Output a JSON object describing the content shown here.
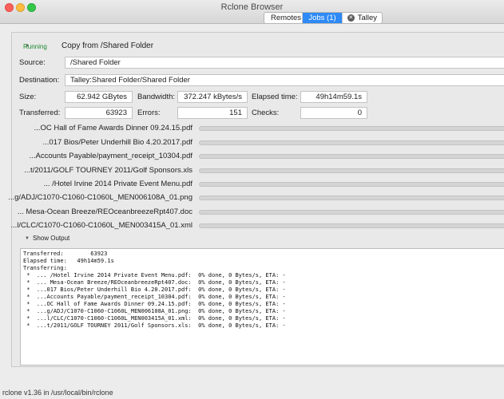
{
  "window": {
    "title": "Rclone Browser"
  },
  "tabs": [
    {
      "label": "Remotes"
    },
    {
      "label": "Jobs (1)"
    },
    {
      "label": "Talley"
    }
  ],
  "job": {
    "status": "Running",
    "title": "Copy from /Shared Folder",
    "source_label": "Source:",
    "source": "/Shared Folder",
    "destination_label": "Destination:",
    "destination": "Talley:Shared Folder/Shared Folder",
    "size_label": "Size:",
    "size": "62.942 GBytes",
    "bandwidth_label": "Bandwidth:",
    "bandwidth": "372.247 kBytes/s",
    "elapsed_label": "Elapsed time:",
    "elapsed": "49h14m59.1s",
    "transferred_label": "Transferred:",
    "transferred": "63923",
    "errors_label": "Errors:",
    "errors": "151",
    "checks_label": "Checks:",
    "checks": "0",
    "files": [
      {
        "name": "...OC Hall of Fame Awards Dinner 09.24.15.pdf",
        "progress": 0
      },
      {
        "name": "...017 Bios/Peter Underhill Bio 4.20.2017.pdf",
        "progress": 0
      },
      {
        "name": "...Accounts Payable/payment_receipt_10304.pdf",
        "progress": 0
      },
      {
        "name": "...t/2011/GOLF TOURNEY 2011/Golf Sponsors.xls",
        "progress": 0
      },
      {
        "name": "... /Hotel Irvine 2014 Private Event Menu.pdf",
        "progress": 0
      },
      {
        "name": "...g/ADJ/C1070-C1060-C1060L_MEN006108A_01.png",
        "progress": 0
      },
      {
        "name": "... Mesa-Ocean Breeze/REOceanbreezeRpt407.doc",
        "progress": 0
      },
      {
        "name": "...l/CLC/C1070-C1060-C1060L_MEN003415A_01.xml",
        "progress": 0
      }
    ],
    "show_output_label": "Show Output",
    "output": "Transferred:        63923\nElapsed time:   49h14m59.1s\nTransferring:\n *  ... /Hotel Irvine 2014 Private Event Menu.pdf:  0% done, 0 Bytes/s, ETA: -\n *  ... Mesa-Ocean Breeze/REOceanbreezeRpt407.doc:  0% done, 0 Bytes/s, ETA: -\n *  ...017 Bios/Peter Underhill Bio 4.20.2017.pdf:  0% done, 0 Bytes/s, ETA: -\n *  ...Accounts Payable/payment_receipt_10304.pdf:  0% done, 0 Bytes/s, ETA: -\n *  ...OC Hall of Fame Awards Dinner 09.24.15.pdf:  0% done, 0 Bytes/s, ETA: -\n *  ...g/ADJ/C1070-C1060-C1060L_MEN006108A_01.png:  0% done, 0 Bytes/s, ETA: -\n *  ...l/CLC/C1070-C1060-C1060L_MEN003415A_01.xml:  0% done, 0 Bytes/s, ETA: -\n *  ...t/2011/GOLF TOURNEY 2011/Golf Sponsors.xls:  0% done, 0 Bytes/s, ETA: -"
  },
  "statusbar": {
    "text": "rclone v1.36 in /usr/local/bin/rclone"
  }
}
